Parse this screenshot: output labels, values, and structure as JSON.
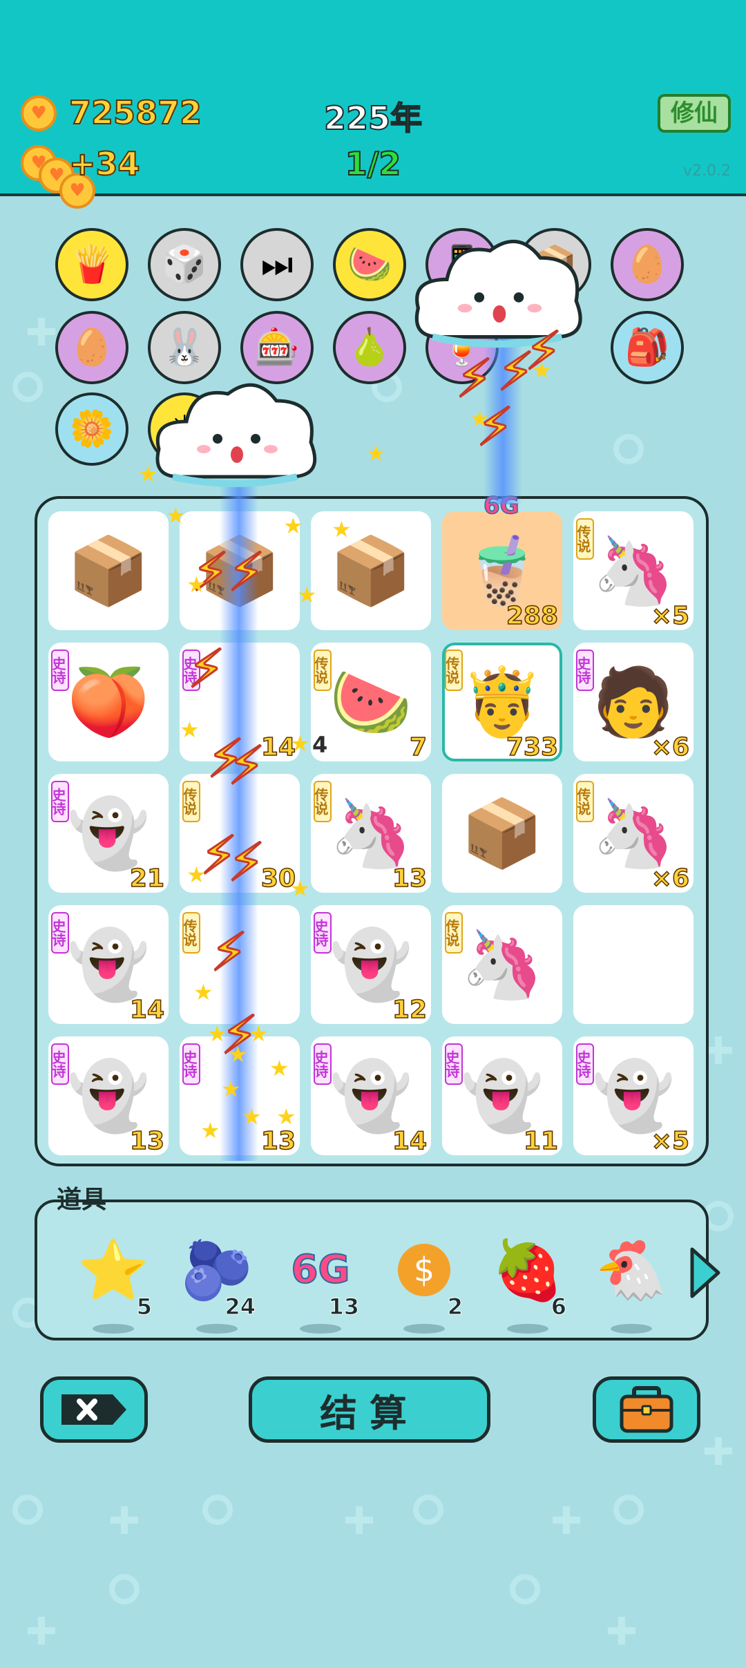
{
  "header": {
    "coins": "725872",
    "coin_rate": "+34",
    "year": "225年",
    "progress": "1/2",
    "cultivate_label": "修仙",
    "version": "v2.0.2"
  },
  "skills": [
    {
      "icon": "🍟",
      "icon_name": "fries-icon",
      "style": "y"
    },
    {
      "icon": "🎲",
      "icon_name": "dice-icon",
      "style": "g"
    },
    {
      "icon": "⏭",
      "icon_name": "skip-icon",
      "style": "g"
    },
    {
      "icon": "🍉",
      "icon_name": "fruit-bowl-icon",
      "style": "y"
    },
    {
      "icon": "📱",
      "icon_name": "phone-icon",
      "style": "p"
    },
    {
      "icon": "📦",
      "icon_name": "box-icon",
      "style": "g"
    },
    {
      "icon": "🥚",
      "icon_name": "egg-icon",
      "style": "p"
    },
    {
      "icon": "🥚",
      "icon_name": "egg-icon",
      "style": "p"
    },
    {
      "icon": "🐰",
      "icon_name": "rabbit-icon",
      "style": "g"
    },
    {
      "icon": "🎰",
      "icon_name": "multiplier-icon",
      "style": "p"
    },
    {
      "icon": "🍐",
      "icon_name": "pear-icon",
      "style": "p"
    },
    {
      "icon": "🍹",
      "icon_name": "drink-icon",
      "style": "p"
    },
    {
      "icon": "🎒",
      "icon_name": "bag-icon",
      "style": "b"
    },
    {
      "icon": "🌼",
      "icon_name": "flower-pot-icon",
      "style": "b"
    },
    {
      "icon": "☀",
      "icon_name": "sun-icon",
      "style": "y"
    }
  ],
  "board_badge": "6G",
  "tags": {
    "epic": "史诗",
    "legend": "传说"
  },
  "cells": [
    {
      "icon": "📦",
      "icon_name": "box-icon",
      "tag": "",
      "count": "",
      "left": ""
    },
    {
      "icon": "📦",
      "icon_name": "box-icon",
      "tag": "",
      "count": "",
      "left": ""
    },
    {
      "icon": "📦",
      "icon_name": "box-icon",
      "tag": "",
      "count": "",
      "left": ""
    },
    {
      "icon": "🧋",
      "icon_name": "bubble-tea-icon",
      "tag": "",
      "count": "288",
      "left": "",
      "bg": "orange"
    },
    {
      "icon": "🦄",
      "icon_name": "unicorn-icon",
      "tag": "legend",
      "count": "×5",
      "left": ""
    },
    {
      "icon": "🍑",
      "icon_name": "peach-icon",
      "tag": "epic",
      "count": "",
      "left": ""
    },
    {
      "icon": "",
      "icon_name": "hidden-item-icon",
      "tag": "epic",
      "count": "14",
      "left": ""
    },
    {
      "icon": "🍉",
      "icon_name": "watermelon-icon",
      "tag": "legend",
      "count": "7",
      "left": "4"
    },
    {
      "icon": "🤴",
      "icon_name": "king-icon",
      "tag": "legend",
      "count": "733",
      "left": "",
      "hl": true
    },
    {
      "icon": "🧑",
      "icon_name": "man-face-icon",
      "tag": "epic",
      "count": "×6",
      "left": ""
    },
    {
      "icon": "👻",
      "icon_name": "ghost-icon",
      "tag": "epic",
      "count": "21",
      "left": ""
    },
    {
      "icon": "",
      "icon_name": "hidden-item-icon",
      "tag": "legend",
      "count": "30",
      "left": ""
    },
    {
      "icon": "🦄",
      "icon_name": "unicorn-icon",
      "tag": "legend",
      "count": "13",
      "left": ""
    },
    {
      "icon": "📦",
      "icon_name": "box-icon",
      "tag": "",
      "count": "",
      "left": ""
    },
    {
      "icon": "🦄",
      "icon_name": "crowned-unicorn-icon",
      "tag": "legend",
      "count": "×6",
      "left": ""
    },
    {
      "icon": "👻",
      "icon_name": "ghost-icon",
      "tag": "epic",
      "count": "14",
      "left": ""
    },
    {
      "icon": "",
      "icon_name": "hidden-item-icon",
      "tag": "legend",
      "count": "",
      "left": ""
    },
    {
      "icon": "👻",
      "icon_name": "ghost-icon",
      "tag": "epic",
      "count": "12",
      "left": ""
    },
    {
      "icon": "🦄",
      "icon_name": "crowned-unicorn-icon",
      "tag": "legend",
      "count": "",
      "left": ""
    },
    {
      "icon": "",
      "icon_name": "empty-slot",
      "tag": "",
      "count": "",
      "left": ""
    },
    {
      "icon": "👻",
      "icon_name": "ghost-icon",
      "tag": "epic",
      "count": "13",
      "left": ""
    },
    {
      "icon": "",
      "icon_name": "hidden-item-icon",
      "tag": "epic",
      "count": "13",
      "left": ""
    },
    {
      "icon": "👻",
      "icon_name": "ghost-icon",
      "tag": "epic",
      "count": "14",
      "left": ""
    },
    {
      "icon": "👻",
      "icon_name": "ghost-icon",
      "tag": "epic",
      "count": "11",
      "left": ""
    },
    {
      "icon": "👻",
      "icon_name": "ghost-icon",
      "tag": "epic",
      "count": "×5",
      "left": ""
    }
  ],
  "props": {
    "label": "道具",
    "items": [
      {
        "icon": "⭐",
        "icon_name": "star-icon",
        "count": "5"
      },
      {
        "icon": "🫐",
        "icon_name": "blueberry-icon",
        "count": "24"
      },
      {
        "icon": "6G",
        "icon_name": "6g-icon",
        "count": "13"
      },
      {
        "icon": "$",
        "icon_name": "dollar-coin-icon",
        "count": "2"
      },
      {
        "icon": "🍓",
        "icon_name": "bayberry-icon",
        "count": "6"
      },
      {
        "icon": "🐔",
        "icon_name": "chicken-icon",
        "count": ""
      }
    ]
  },
  "buttons": {
    "settle_label": "结算"
  },
  "colors": {
    "header": "#13c6c6",
    "background": "#a8dee3",
    "button": "#3ccfd0",
    "coin": "#ffc83a"
  }
}
